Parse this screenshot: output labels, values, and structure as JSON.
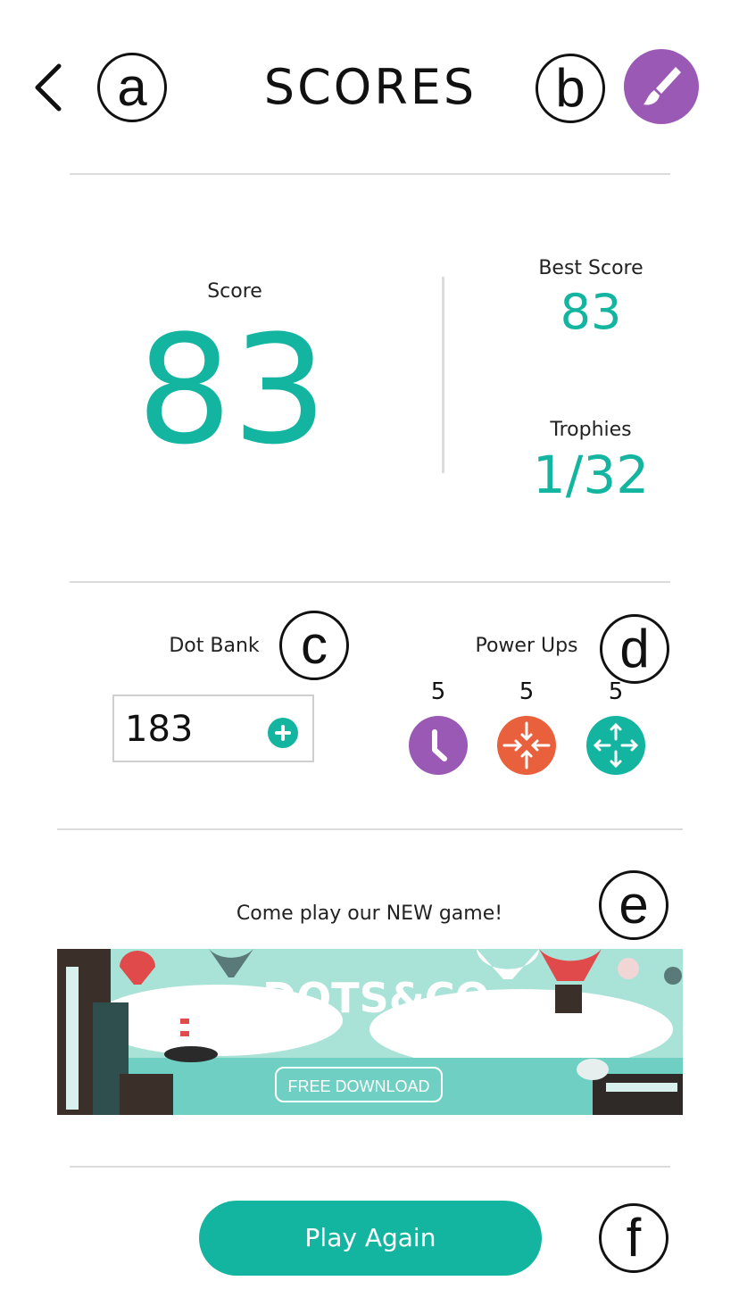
{
  "header": {
    "title": "SCORES",
    "back_icon": "chevron-left-icon",
    "theme_icon": "paintbrush-icon",
    "theme_color": "#9b59b6"
  },
  "callouts": {
    "a": "a",
    "b": "b",
    "c": "c",
    "d": "d",
    "e": "e",
    "f": "f"
  },
  "score": {
    "label": "Score",
    "value": "83"
  },
  "best_score": {
    "label": "Best Score",
    "value": "83"
  },
  "trophies": {
    "label": "Trophies",
    "value": "1/32"
  },
  "dot_bank": {
    "label": "Dot Bank",
    "value": "183",
    "add_icon": "plus-icon"
  },
  "power_ups": {
    "label": "Power Ups",
    "items": [
      {
        "count": "5",
        "icon": "clock-icon",
        "color": "#9b59b6"
      },
      {
        "count": "5",
        "icon": "shrink-arrows-icon",
        "color": "#e8603c"
      },
      {
        "count": "5",
        "icon": "expand-arrows-icon",
        "color": "#13b5a0"
      }
    ]
  },
  "promo": {
    "heading": "Come play our NEW game!",
    "banner_title": "DOTS&CO",
    "banner_button": "FREE DOWNLOAD"
  },
  "actions": {
    "play_again": "Play Again"
  },
  "colors": {
    "accent": "#13b5a0",
    "divider": "#dcdcdc"
  }
}
